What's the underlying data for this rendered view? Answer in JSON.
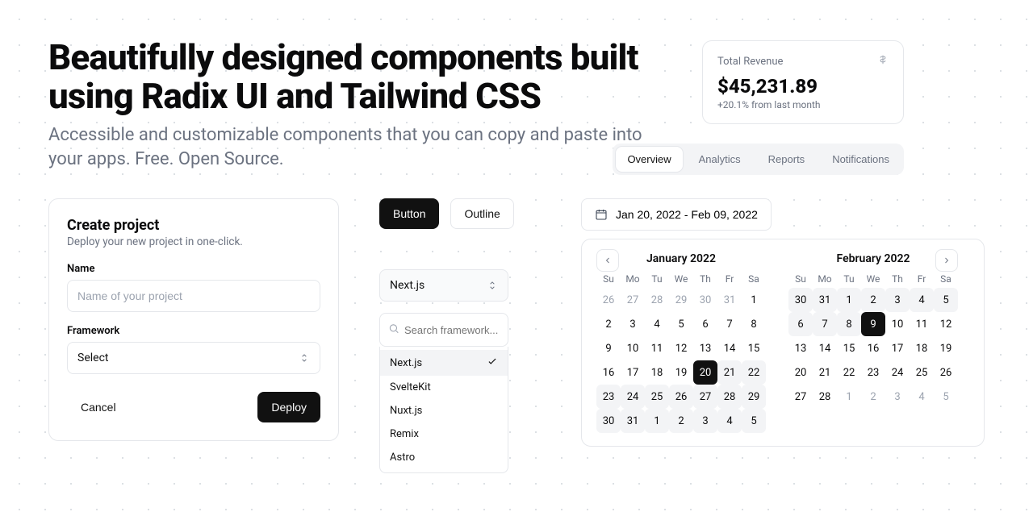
{
  "hero": {
    "title": "Beautifully designed components built using Radix UI and Tailwind CSS",
    "subtitle": "Accessible and customizable components that you can copy and paste into your apps. Free. Open Source."
  },
  "revenue": {
    "label": "Total Revenue",
    "amount": "$45,231.89",
    "delta": "+20.1% from last month"
  },
  "tabs": {
    "items": [
      "Overview",
      "Analytics",
      "Reports",
      "Notifications"
    ],
    "active": 0
  },
  "project": {
    "title": "Create project",
    "subtitle": "Deploy your new project in one-click.",
    "name_label": "Name",
    "name_placeholder": "Name of your project",
    "framework_label": "Framework",
    "framework_value": "Select",
    "cancel": "Cancel",
    "deploy": "Deploy"
  },
  "buttons": {
    "primary": "Button",
    "outline": "Outline"
  },
  "combobox": {
    "value": "Next.js",
    "search_placeholder": "Search framework...",
    "options": [
      "Next.js",
      "SvelteKit",
      "Nuxt.js",
      "Remix",
      "Astro"
    ],
    "selected": 0
  },
  "date_range": {
    "display": "Jan 20, 2022 - Feb 09, 2022"
  },
  "calendar": {
    "dow": [
      "Su",
      "Mo",
      "Tu",
      "We",
      "Th",
      "Fr",
      "Sa"
    ],
    "months": [
      {
        "title": "January 2022",
        "nav": "prev",
        "days": [
          {
            "n": 26,
            "out": true
          },
          {
            "n": 27,
            "out": true
          },
          {
            "n": 28,
            "out": true
          },
          {
            "n": 29,
            "out": true
          },
          {
            "n": 30,
            "out": true
          },
          {
            "n": 31,
            "out": true
          },
          {
            "n": 1
          },
          {
            "n": 2
          },
          {
            "n": 3
          },
          {
            "n": 4
          },
          {
            "n": 5
          },
          {
            "n": 6
          },
          {
            "n": 7
          },
          {
            "n": 8
          },
          {
            "n": 9
          },
          {
            "n": 10
          },
          {
            "n": 11
          },
          {
            "n": 12
          },
          {
            "n": 13
          },
          {
            "n": 14
          },
          {
            "n": 15
          },
          {
            "n": 16
          },
          {
            "n": 17
          },
          {
            "n": 18
          },
          {
            "n": 19
          },
          {
            "n": 20,
            "sel": true
          },
          {
            "n": 21,
            "range": true
          },
          {
            "n": 22,
            "range": true
          },
          {
            "n": 23,
            "range": true
          },
          {
            "n": 24,
            "range": true
          },
          {
            "n": 25,
            "range": true
          },
          {
            "n": 26,
            "range": true
          },
          {
            "n": 27,
            "range": true
          },
          {
            "n": 28,
            "range": true
          },
          {
            "n": 29,
            "range": true
          },
          {
            "n": 30,
            "range": true
          },
          {
            "n": 31,
            "range": true
          },
          {
            "n": 1,
            "range": true
          },
          {
            "n": 2,
            "range": true
          },
          {
            "n": 3,
            "range": true
          },
          {
            "n": 4,
            "range": true
          },
          {
            "n": 5,
            "range": true
          }
        ]
      },
      {
        "title": "February 2022",
        "nav": "next",
        "days": [
          {
            "n": 30,
            "range": true
          },
          {
            "n": 31,
            "range": true
          },
          {
            "n": 1,
            "range": true
          },
          {
            "n": 2,
            "range": true
          },
          {
            "n": 3,
            "range": true
          },
          {
            "n": 4,
            "range": true
          },
          {
            "n": 5,
            "range": true
          },
          {
            "n": 6,
            "range": true
          },
          {
            "n": 7,
            "range": true
          },
          {
            "n": 8,
            "range": true
          },
          {
            "n": 9,
            "sel": true
          },
          {
            "n": 10
          },
          {
            "n": 11
          },
          {
            "n": 12
          },
          {
            "n": 13
          },
          {
            "n": 14
          },
          {
            "n": 15
          },
          {
            "n": 16
          },
          {
            "n": 17
          },
          {
            "n": 18
          },
          {
            "n": 19
          },
          {
            "n": 20
          },
          {
            "n": 21
          },
          {
            "n": 22
          },
          {
            "n": 23
          },
          {
            "n": 24
          },
          {
            "n": 25
          },
          {
            "n": 26
          },
          {
            "n": 27
          },
          {
            "n": 28
          },
          {
            "n": 1,
            "out": true
          },
          {
            "n": 2,
            "out": true
          },
          {
            "n": 3,
            "out": true
          },
          {
            "n": 4,
            "out": true
          },
          {
            "n": 5,
            "out": true
          }
        ]
      }
    ]
  }
}
